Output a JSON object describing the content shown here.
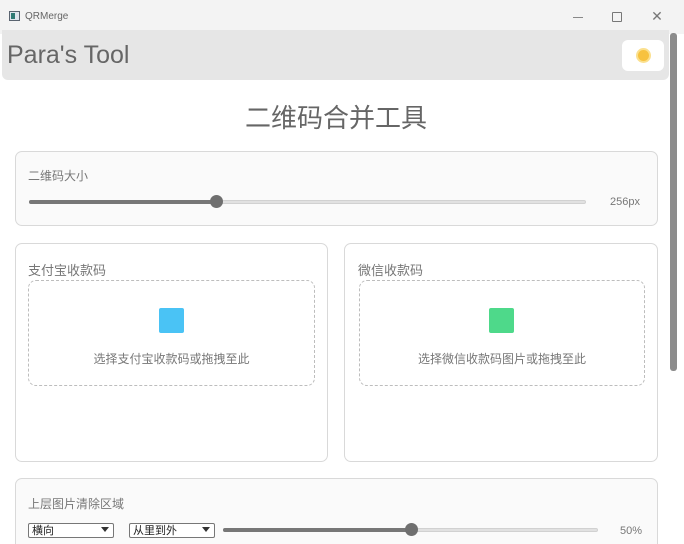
{
  "window": {
    "title": "QRMerge"
  },
  "header": {
    "title": "Para's Tool",
    "theme_icon": "sun-icon"
  },
  "page": {
    "heading": "二维码合并工具"
  },
  "size_section": {
    "label": "二维码大小",
    "value_text": "256px",
    "slider_fraction": 0.336
  },
  "alipay": {
    "label": "支付宝收款码",
    "drop_text": "选择支付宝收款码或拖拽至此",
    "icon_color": "#4ac3f5"
  },
  "wechat": {
    "label": "微信收款码",
    "drop_text": "选择微信收款码图片或拖拽至此",
    "icon_color": "#4ed98a"
  },
  "clear_section": {
    "label": "上层图片清除区域",
    "direction_select": "横向",
    "order_select": "从里到外",
    "value_text": "50%",
    "slider_fraction": 0.5
  },
  "colors": {
    "accent": "#6f6f6f",
    "header_bg": "#e6e6e6"
  }
}
